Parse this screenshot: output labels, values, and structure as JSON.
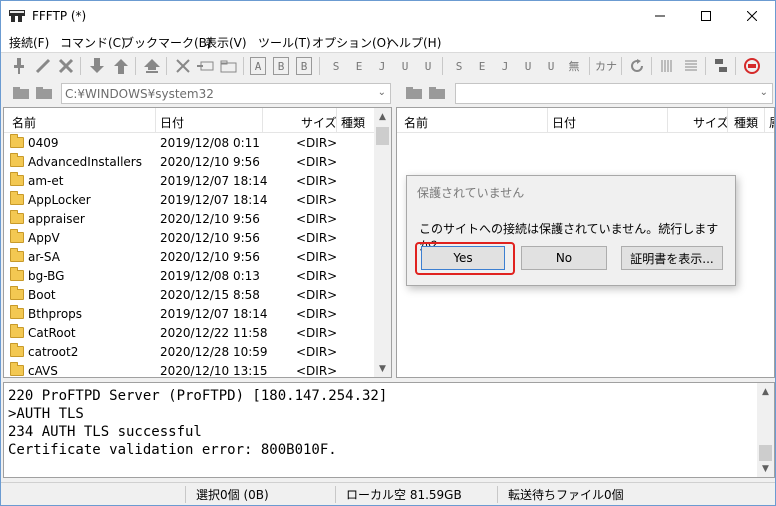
{
  "window": {
    "title": "FFFTP (*)",
    "controls": {
      "minimize": "–",
      "maximize": "□",
      "close": "✕"
    }
  },
  "menu": [
    "接続(F)",
    "コマンド(C)",
    "ブックマーク(B)",
    "表示(V)",
    "ツール(T)",
    "オプション(O)",
    "ヘルプ(H)"
  ],
  "toolbar": {
    "icons": [
      "connect-icon",
      "quick-connect-icon",
      "disconnect-icon",
      "download-icon",
      "upload-icon",
      "mirror-upload-icon",
      "delete-icon",
      "rename-icon",
      "mkdir-icon",
      "ascii-mode",
      "binary-mode",
      "auto-mode",
      "sjis",
      "euc",
      "jis",
      "utf8",
      "utf8-bom",
      "no-conv",
      "kana-icon",
      "refresh-icon",
      "list-view-icon",
      "detail-view-icon",
      "sync-icon",
      "stop-icon"
    ],
    "labels": {
      "ascii": "A",
      "binary": "B",
      "auto": "B",
      "local_sjis": "S",
      "local_euc": "E",
      "local_jis": "J",
      "local_utf8": "U",
      "local_utf8b": "U",
      "remote_sjis": "S",
      "remote_euc": "E",
      "remote_jis": "J",
      "remote_utf8": "U",
      "remote_utf8b": "U",
      "noconv": "無",
      "kana": "カナ"
    }
  },
  "local": {
    "path": "C:¥WINDOWS¥system32",
    "columns": {
      "name": "名前",
      "date": "日付",
      "size": "サイズ",
      "type": "種類"
    },
    "rows": [
      {
        "name": "0409",
        "date": "2019/12/08  0:11",
        "size": "<DIR>"
      },
      {
        "name": "AdvancedInstallers",
        "date": "2020/12/10  9:56",
        "size": "<DIR>"
      },
      {
        "name": "am-et",
        "date": "2019/12/07 18:14",
        "size": "<DIR>"
      },
      {
        "name": "AppLocker",
        "date": "2019/12/07 18:14",
        "size": "<DIR>"
      },
      {
        "name": "appraiser",
        "date": "2020/12/10  9:56",
        "size": "<DIR>"
      },
      {
        "name": "AppV",
        "date": "2020/12/10  9:56",
        "size": "<DIR>"
      },
      {
        "name": "ar-SA",
        "date": "2020/12/10  9:56",
        "size": "<DIR>"
      },
      {
        "name": "bg-BG",
        "date": "2019/12/08  0:13",
        "size": "<DIR>"
      },
      {
        "name": "Boot",
        "date": "2020/12/15  8:58",
        "size": "<DIR>"
      },
      {
        "name": "Bthprops",
        "date": "2019/12/07 18:14",
        "size": "<DIR>"
      },
      {
        "name": "CatRoot",
        "date": "2020/12/22 11:58",
        "size": "<DIR>"
      },
      {
        "name": "catroot2",
        "date": "2020/12/28 10:59",
        "size": "<DIR>"
      },
      {
        "name": "cAVS",
        "date": "2020/12/10 13:15",
        "size": "<DIR>"
      }
    ]
  },
  "remote": {
    "path": "",
    "columns": {
      "name": "名前",
      "date": "日付",
      "size": "サイズ",
      "type": "種類",
      "attr": "属"
    }
  },
  "log": [
    "220 ProFTPD Server (ProFTPD) [180.147.254.32]",
    ">AUTH TLS",
    "234 AUTH TLS successful",
    "Certificate validation error: 800B010F."
  ],
  "status": {
    "selected": "選択0個 (0B)",
    "local_free": "ローカル空 81.59GB",
    "queue": "転送待ちファイル0個"
  },
  "dialog": {
    "title": "保護されていません",
    "message": "このサイトへの接続は保護されていません。続行しますか？",
    "yes": "Yes",
    "no": "No",
    "cert": "証明書を表示..."
  },
  "colors": {
    "folder": "#f3c852",
    "highlight": "#e0221f",
    "accent_border": "#6b9bd1"
  }
}
